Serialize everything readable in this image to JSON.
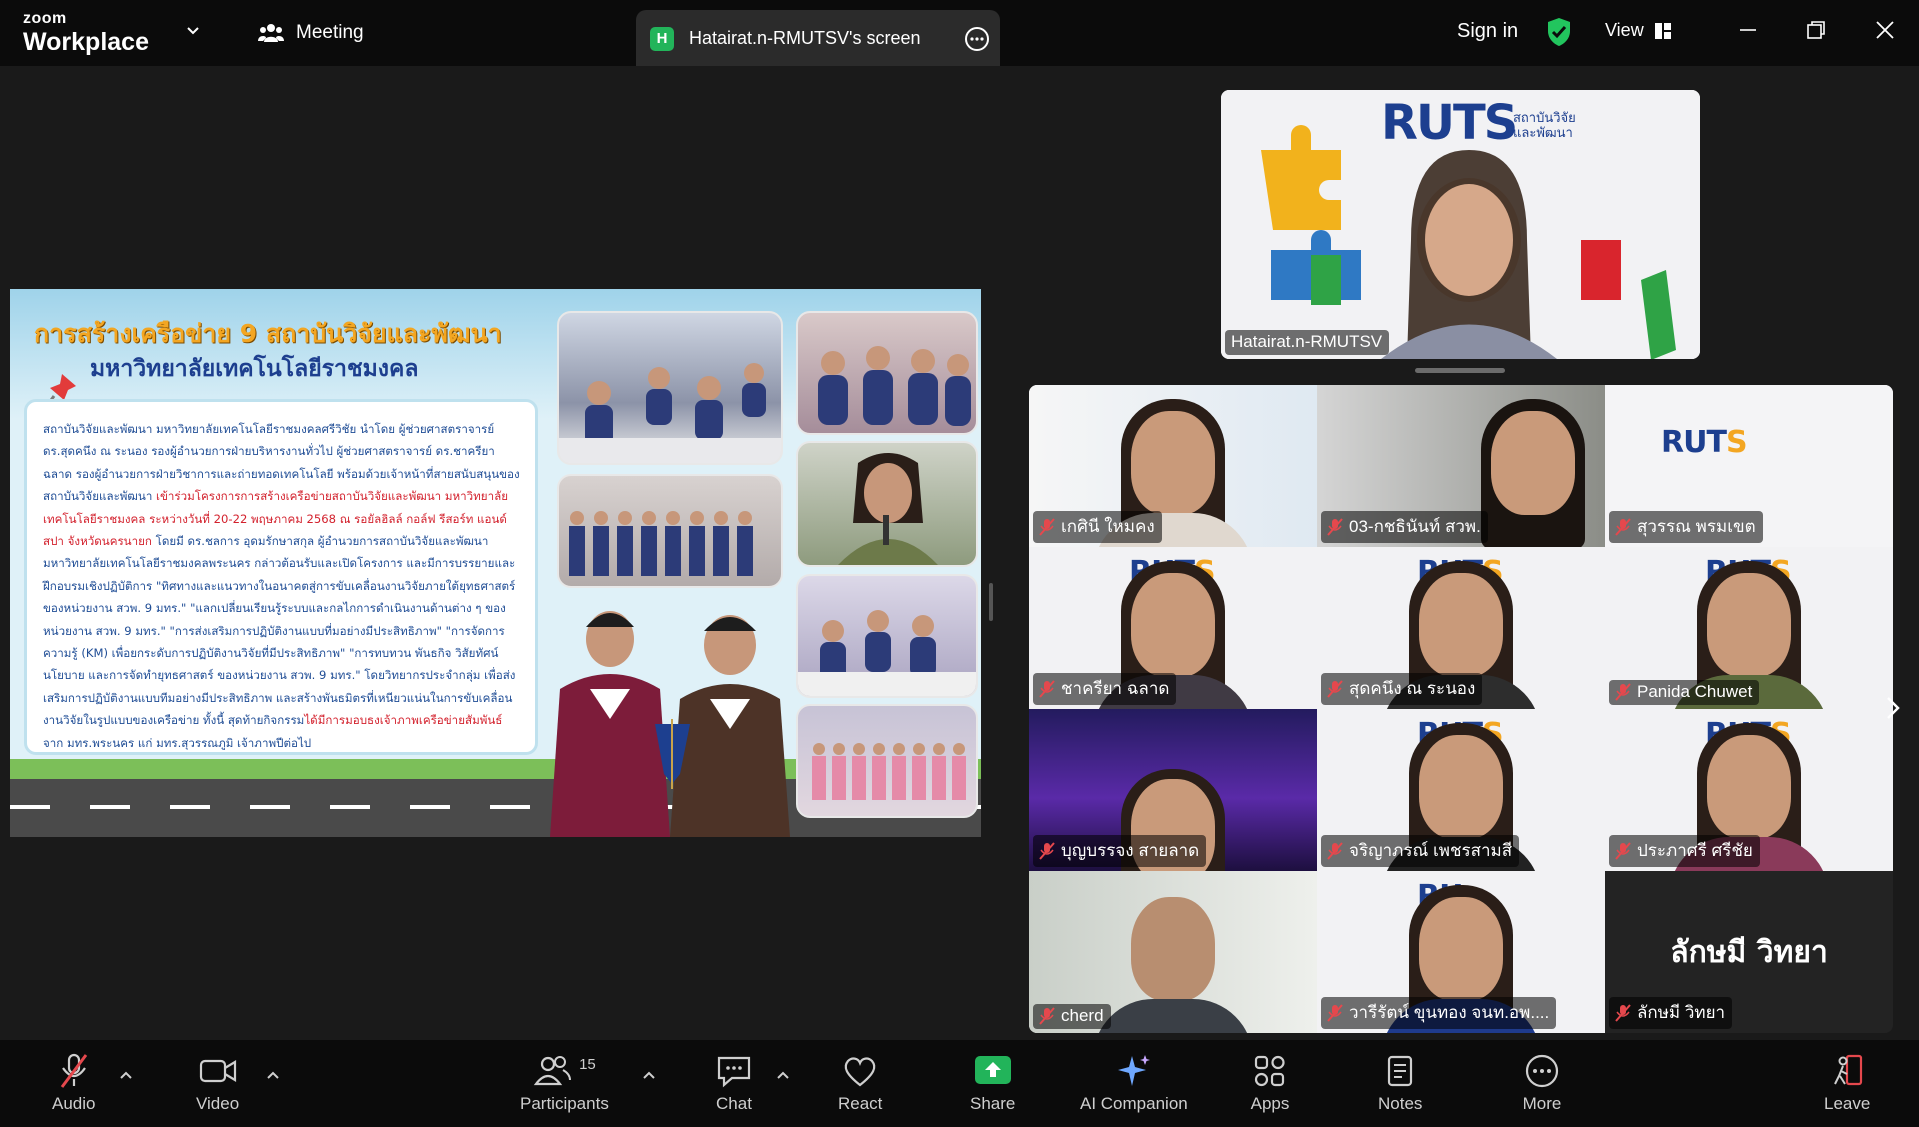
{
  "app": {
    "brand_small": "zoom",
    "brand_big": "Workplace"
  },
  "topbar": {
    "meeting_label": "Meeting",
    "share_tab_badge": "H",
    "share_tab_title": "Hatairat.n-RMUTSV's screen",
    "sign_in": "Sign in",
    "view_label": "View"
  },
  "slide": {
    "title_line1": "การสร้างเครือข่าย 9 สถาบันวิจัยและพัฒนา",
    "title_line2": "มหาวิทยาลัยเทคโนโลยีราชมงคล",
    "body_1": "สถาบันวิจัยและพัฒนา มหาวิทยาลัยเทคโนโลยีราชมงคลศรีวิชัย นำโดย ผู้ช่วยศาสตราจารย์ ดร.สุดคนึง ณ ระนอง รองผู้อำนวยการฝ่ายบริหารงานทั่วไป ผู้ช่วยศาสตราจารย์ ดร.ชาครียา ฉลาด รองผู้อำนวยการฝ่ายวิชาการและถ่ายทอดเทคโนโลยี พร้อมด้วยเจ้าหน้าที่สายสนับสนุนของสถาบันวิจัยและพัฒนา ",
    "body_red_1": "เข้าร่วมโครงการการสร้างเครือข่ายสถาบันวิจัยและพัฒนา มหาวิทยาลัยเทคโนโลยีราชมงคล ระหว่างวันที่ 20-22 พฤษภาคม 2568 ณ รอยัลฮิลล์ กอล์ฟ รีสอร์ท แอนด์ สปา จังหวัดนครนายก",
    "body_2": " โดยมี ดร.ชลการ อุดมรักษาสกุล ผู้อำนวยการสถาบันวิจัยและพัฒนา มหาวิทยาลัยเทคโนโลยีราชมงคลพระนคร กล่าวต้อนรับและเปิดโครงการ และมีการบรรยายและฝึกอบรมเชิงปฏิบัติการ \"ทิศทางและแนวทางในอนาคตสู่การขับเคลื่อนงานวิจัยภายใต้ยุทธศาสตร์ของหน่วยงาน สวพ. 9 มทร.\" \"แลกเปลี่ยนเรียนรู้ระบบและกลไกการดำเนินงานด้านต่าง ๆ ของหน่วยงาน สวพ. 9 มทร.\" \"การส่งเสริมการปฏิบัติงานแบบที่มอย่างมีประสิทธิภาพ\" \"การจัดการความรู้ (KM) เพื่อยกระดับการปฏิบัติงานวิจัยที่มีประสิทธิภาพ\" \"การทบทวน พันธกิจ วิสัยทัศน์ นโยบาย และการจัดทำยุทธศาสตร์ ของหน่วยงาน สวพ. 9 มทร.\" โดยวิทยากรประจำกลุ่ม เพื่อส่งเสริมการปฏิบัติงานแบบทีมอย่างมีประสิทธิภาพ และสร้างพันธมิตรที่เหนียวแน่นในการขับเคลื่อนงานวิจัยในรูปแบบของเครือข่าย ทั้งนี้ สุดท้ายกิจกรรม",
    "body_red_2": "ได้มีการมอบธงเจ้าภาพเครือข่ายสัมพันธ์",
    "body_3": " จาก มทร.พระนคร แก่ มทร.สุวรรณภูมิ เจ้าภาพปีต่อไป"
  },
  "speaker": {
    "name": "Hatairat.n-RMUTSV",
    "logo": "RUTS",
    "logo_sub": "สถาบันวิจัยและพัฒนา"
  },
  "gallery": [
    {
      "name": "เกศินี ใหมคง",
      "muted": true
    },
    {
      "name": "03-กชธินันท์ สวพ.",
      "muted": true
    },
    {
      "name": "สุวรรณ พรมเขต",
      "muted": true
    },
    {
      "name": "ชาครียา ฉลาด",
      "muted": true
    },
    {
      "name": "สุดคนึง ณ ระนอง",
      "muted": true
    },
    {
      "name": "Panida Chuwet",
      "muted": true
    },
    {
      "name": "บุญบรรจง สายลาด",
      "muted": true
    },
    {
      "name": "จริญาภรณ์ เพชรสามสี",
      "muted": true
    },
    {
      "name": "ประภาศรี ศรีชัย",
      "muted": true
    },
    {
      "name": "cherd",
      "muted": true
    },
    {
      "name": "วารีรัตน์ ขุนทอง จนท.อพ....",
      "muted": true
    },
    {
      "name": "ลักษมี วิทยา",
      "muted": true,
      "video_off_label": "ลักษมี วิทยา"
    }
  ],
  "toolbar": {
    "audio": "Audio",
    "video": "Video",
    "participants": "Participants",
    "participants_count": "15",
    "chat": "Chat",
    "react": "React",
    "share": "Share",
    "ai_companion": "AI Companion",
    "apps": "Apps",
    "notes": "Notes",
    "more": "More",
    "leave": "Leave"
  },
  "colors": {
    "accent_green": "#22c55e",
    "leave_red": "#e5484d",
    "muted_red": "#e5484d",
    "share_green": "#22b45a"
  }
}
